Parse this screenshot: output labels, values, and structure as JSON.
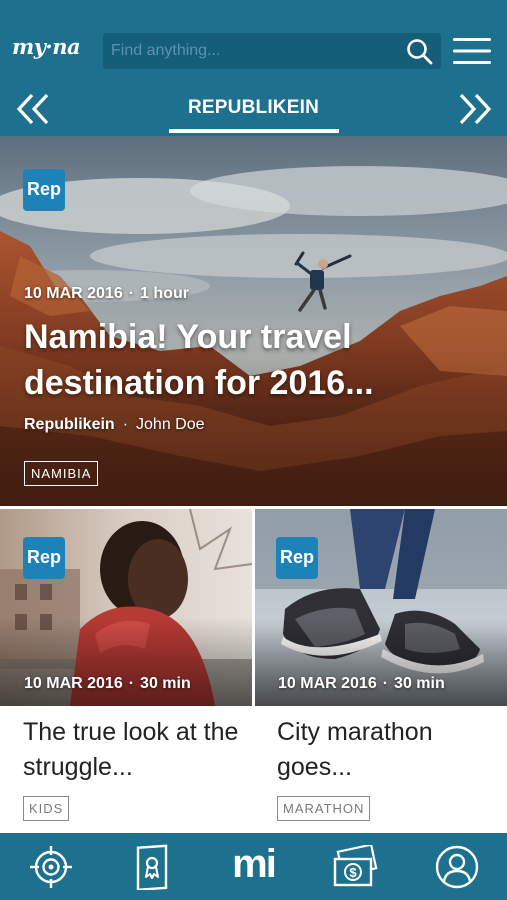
{
  "header": {
    "logo_text": "my·na",
    "search_placeholder": "Find anything...",
    "section_title": "REPUBLIKEIN"
  },
  "hero": {
    "badge": "Rep",
    "date": "10 MAR 2016",
    "age": "1 hour",
    "title": "Namibia! Your travel destination for 2016...",
    "source": "Republikein",
    "author": "John Doe",
    "tag": "NAMIBIA"
  },
  "cards": [
    {
      "badge": "Rep",
      "date": "10 MAR 2016",
      "age": "30 min",
      "title": "The true look at the struggle...",
      "tag": "KIDS"
    },
    {
      "badge": "Rep",
      "date": "10 MAR 2016",
      "age": "30 min",
      "title": "City marathon goes...",
      "tag": "MARATHON"
    }
  ],
  "bottom_nav": {
    "items": [
      "target-icon",
      "certificate-icon",
      "mi-home-logo",
      "money-icon",
      "profile-icon"
    ],
    "center_logo_text": "mi"
  },
  "colors": {
    "brand_blue": "#1d718e",
    "search_bg": "#145e79",
    "badge_blue": "#1d82b8"
  }
}
